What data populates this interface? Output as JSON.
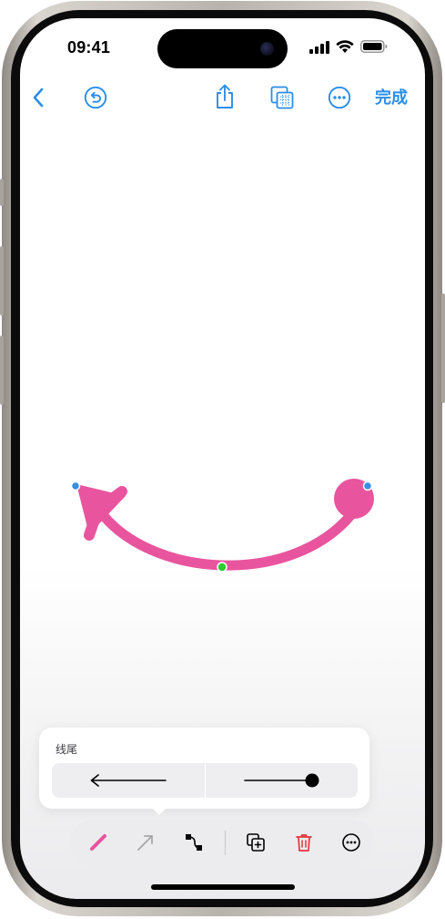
{
  "status_bar": {
    "time": "09:41",
    "icons": [
      "cellular-signal-icon",
      "wifi-icon",
      "battery-icon"
    ]
  },
  "toolbar_top": {
    "buttons": [
      "back-chevron-icon",
      "undo-icon",
      "share-icon",
      "layers-icon",
      "more-icon"
    ],
    "done_label": "完成"
  },
  "colors": {
    "accent": "#2a8ee8",
    "stroke": "#e8559e",
    "handle": "#3a8fe0",
    "midpoint": "#2ecc2e",
    "delete": "#e5333a"
  },
  "canvas": {
    "shape": "curved-arrow",
    "start_marker": "arrowhead",
    "end_marker": "filled-circle"
  },
  "line_end_popover": {
    "title": "线尾",
    "options": [
      "arrow-left-option",
      "line-dot-option"
    ]
  },
  "bottom_toolbar": {
    "tools": [
      "stroke-color-icon",
      "line-style-icon",
      "path-edit-icon",
      "duplicate-icon",
      "delete-icon",
      "more-icon"
    ]
  }
}
